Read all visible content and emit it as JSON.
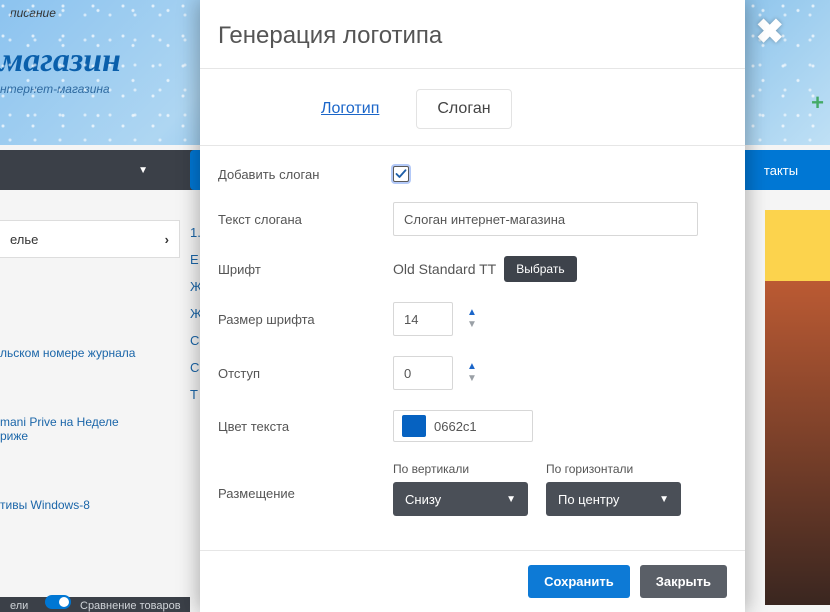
{
  "background": {
    "top_label": "писание",
    "logo_text": "магазин",
    "slogan_text": "нтернет-магазина",
    "contacts_btn": "такты",
    "sidebar_category": "елье",
    "article1": "льском номере журнала",
    "article2": "mani Prive на Неделе\nриже",
    "article3": "тивы Windows-8",
    "cut_list": [
      "1.",
      "Е",
      "Ж",
      "Ж",
      "С",
      "С",
      "Т"
    ],
    "bottom_label": "Сравнение товаров",
    "bottom_cut": "ели"
  },
  "modal": {
    "title": "Генерация логотипа",
    "tabs": {
      "logo": "Логотип",
      "slogan": "Слоган"
    },
    "labels": {
      "add_slogan": "Добавить слоган",
      "slogan_text": "Текст слогана",
      "font": "Шрифт",
      "font_size": "Размер шрифта",
      "indent": "Отступ",
      "text_color": "Цвет текста",
      "placement": "Размещение",
      "vertical": "По вертикали",
      "horizontal": "По горизонтали"
    },
    "values": {
      "add_slogan_checked": true,
      "slogan_text": "Слоган интернет-магазина",
      "font_name": "Old Standard TT",
      "font_select_btn": "Выбрать",
      "font_size": "14",
      "indent": "0",
      "color_hex": "0662c1",
      "vertical_selected": "Снизу",
      "horizontal_selected": "По центру"
    },
    "footer": {
      "save": "Сохранить",
      "close": "Закрыть"
    }
  }
}
